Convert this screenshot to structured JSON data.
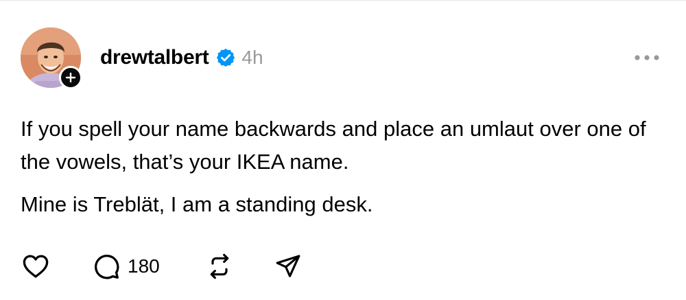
{
  "post": {
    "author": {
      "username": "drewtalbert",
      "verified": true,
      "avatar_icon": "profile-photo",
      "follow_icon": "plus-icon"
    },
    "timestamp": "4h",
    "more_icon": "more-horizontal-icon",
    "body": {
      "paragraph_1": "If you spell your name backwards and place an umlaut over one of the vowels, that’s your IKEA name.",
      "paragraph_2": "Mine is Treblät, I am a standing desk."
    },
    "actions": {
      "like_icon": "heart-icon",
      "comment_icon": "comment-icon",
      "comment_count": "180",
      "repost_icon": "repost-icon",
      "share_icon": "send-icon"
    }
  },
  "colors": {
    "text": "#000000",
    "muted": "#999999",
    "verified_blue": "#0095f6",
    "badge_bg": "#0a0a0a"
  }
}
